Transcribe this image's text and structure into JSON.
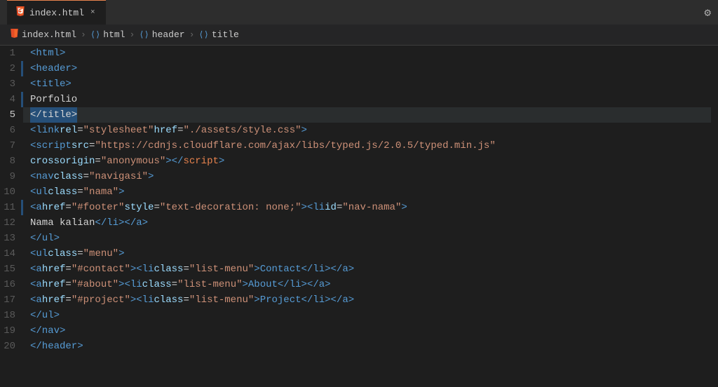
{
  "titleBar": {
    "tab": {
      "label": "index.html",
      "closeIcon": "×"
    },
    "settingsIcon": "⚙"
  },
  "breadcrumb": {
    "items": [
      {
        "label": "index.html",
        "type": "file"
      },
      {
        "label": "html",
        "type": "tag"
      },
      {
        "label": "header",
        "type": "tag"
      },
      {
        "label": "title",
        "type": "tag"
      }
    ],
    "separator": "›"
  },
  "lines": [
    {
      "num": 1,
      "hasBlueBar": false,
      "isActive": false,
      "tokens": [
        {
          "type": "c-text",
          "val": "  "
        },
        {
          "type": "c-tag",
          "val": "<html>"
        }
      ]
    },
    {
      "num": 2,
      "hasBlueBar": true,
      "isActive": false,
      "tokens": [
        {
          "type": "c-text",
          "val": "    "
        },
        {
          "type": "c-tag",
          "val": "<header>"
        }
      ]
    },
    {
      "num": 3,
      "hasBlueBar": false,
      "isActive": false,
      "tokens": [
        {
          "type": "c-text",
          "val": "        "
        },
        {
          "type": "c-tag",
          "val": "<title>"
        }
      ]
    },
    {
      "num": 4,
      "hasBlueBar": true,
      "isActive": false,
      "tokens": [
        {
          "type": "c-text",
          "val": "            Porfolio"
        }
      ]
    },
    {
      "num": 5,
      "hasBlueBar": false,
      "isActive": true,
      "isSelectedLine": true,
      "tokens": [
        {
          "type": "c-text",
          "val": "        "
        },
        {
          "type": "sel",
          "val": "</title>"
        }
      ]
    },
    {
      "num": 6,
      "hasBlueBar": false,
      "isActive": false,
      "tokens": [
        {
          "type": "c-text",
          "val": "        "
        },
        {
          "type": "c-tag",
          "val": "<link "
        },
        {
          "type": "c-attr",
          "val": "rel"
        },
        {
          "type": "c-text",
          "val": "="
        },
        {
          "type": "c-str",
          "val": "\"stylesheet\""
        },
        {
          "type": "c-text",
          "val": " "
        },
        {
          "type": "c-attr",
          "val": "href"
        },
        {
          "type": "c-text",
          "val": "="
        },
        {
          "type": "c-str",
          "val": "\"./assets/style.css\""
        },
        {
          "type": "c-tag",
          "val": ">"
        }
      ]
    },
    {
      "num": 7,
      "hasBlueBar": false,
      "isActive": false,
      "tokens": [
        {
          "type": "c-text",
          "val": "        "
        },
        {
          "type": "c-tag",
          "val": "<script "
        },
        {
          "type": "c-attr",
          "val": "src"
        },
        {
          "type": "c-text",
          "val": "="
        },
        {
          "type": "c-str",
          "val": "\"https://cdnjs.cloudflare.com/ajax/libs/typed.js/2.0.5/typed.min.js\""
        }
      ]
    },
    {
      "num": 8,
      "hasBlueBar": false,
      "isActive": false,
      "tokens": [
        {
          "type": "c-text",
          "val": "        "
        },
        {
          "type": "c-attr",
          "val": "crossorigin"
        },
        {
          "type": "c-text",
          "val": "="
        },
        {
          "type": "c-str",
          "val": "\"anonymous\""
        },
        {
          "type": "c-tag",
          "val": "></"
        },
        {
          "type": "c-orange",
          "val": "script"
        },
        {
          "type": "c-tag",
          "val": ">"
        }
      ]
    },
    {
      "num": 9,
      "hasBlueBar": false,
      "isActive": false,
      "tokens": [
        {
          "type": "c-text",
          "val": "        "
        },
        {
          "type": "c-tag",
          "val": "<nav "
        },
        {
          "type": "c-attr",
          "val": "class"
        },
        {
          "type": "c-text",
          "val": "="
        },
        {
          "type": "c-str",
          "val": "\"navigasi\""
        },
        {
          "type": "c-tag",
          "val": ">"
        }
      ]
    },
    {
      "num": 10,
      "hasBlueBar": false,
      "isActive": false,
      "tokens": [
        {
          "type": "c-text",
          "val": "            "
        },
        {
          "type": "c-tag",
          "val": "<ul "
        },
        {
          "type": "c-attr",
          "val": "class"
        },
        {
          "type": "c-text",
          "val": "="
        },
        {
          "type": "c-str",
          "val": "\"nama\""
        },
        {
          "type": "c-text",
          "val": " "
        },
        {
          "type": "c-tag",
          "val": ">"
        }
      ]
    },
    {
      "num": 11,
      "hasBlueBar": true,
      "isActive": false,
      "tokens": [
        {
          "type": "c-text",
          "val": "            "
        },
        {
          "type": "c-tag",
          "val": "<a "
        },
        {
          "type": "c-attr",
          "val": "href"
        },
        {
          "type": "c-text",
          "val": "="
        },
        {
          "type": "c-str",
          "val": "\"#footer\""
        },
        {
          "type": "c-text",
          "val": " "
        },
        {
          "type": "c-attr",
          "val": "style"
        },
        {
          "type": "c-text",
          "val": "="
        },
        {
          "type": "c-str",
          "val": "\"text-decoration: none;\""
        },
        {
          "type": "c-tag",
          "val": "><li "
        },
        {
          "type": "c-attr",
          "val": "id"
        },
        {
          "type": "c-text",
          "val": "="
        },
        {
          "type": "c-str",
          "val": "\"nav-nama\""
        },
        {
          "type": "c-tag",
          "val": ">"
        }
      ]
    },
    {
      "num": 12,
      "hasBlueBar": false,
      "isActive": false,
      "tokens": [
        {
          "type": "c-text",
          "val": "                Nama kalian"
        },
        {
          "type": "c-tag",
          "val": "</li></a>"
        }
      ]
    },
    {
      "num": 13,
      "hasBlueBar": false,
      "isActive": false,
      "tokens": [
        {
          "type": "c-text",
          "val": "            "
        },
        {
          "type": "c-tag",
          "val": "</ul>"
        }
      ]
    },
    {
      "num": 14,
      "hasBlueBar": false,
      "isActive": false,
      "tokens": [
        {
          "type": "c-text",
          "val": "            "
        },
        {
          "type": "c-tag",
          "val": "<ul "
        },
        {
          "type": "c-attr",
          "val": "class"
        },
        {
          "type": "c-text",
          "val": "="
        },
        {
          "type": "c-str",
          "val": "\"menu\""
        },
        {
          "type": "c-tag",
          "val": ">"
        }
      ]
    },
    {
      "num": 15,
      "hasBlueBar": false,
      "isActive": false,
      "tokens": [
        {
          "type": "c-text",
          "val": "                "
        },
        {
          "type": "c-tag",
          "val": "<a "
        },
        {
          "type": "c-attr",
          "val": "href"
        },
        {
          "type": "c-text",
          "val": "="
        },
        {
          "type": "c-str",
          "val": "\"#contact\""
        },
        {
          "type": "c-tag",
          "val": "><li "
        },
        {
          "type": "c-attr",
          "val": "class"
        },
        {
          "type": "c-text",
          "val": "="
        },
        {
          "type": "c-str",
          "val": "\"list-menu\""
        },
        {
          "type": "c-tag",
          "val": ">Contact</li></a>"
        }
      ]
    },
    {
      "num": 16,
      "hasBlueBar": false,
      "isActive": false,
      "tokens": [
        {
          "type": "c-text",
          "val": "                "
        },
        {
          "type": "c-tag",
          "val": "<a "
        },
        {
          "type": "c-attr",
          "val": "href"
        },
        {
          "type": "c-text",
          "val": "="
        },
        {
          "type": "c-str",
          "val": "\"#about\""
        },
        {
          "type": "c-tag",
          "val": "><li "
        },
        {
          "type": "c-attr",
          "val": "class"
        },
        {
          "type": "c-text",
          "val": "="
        },
        {
          "type": "c-str",
          "val": "\"list-menu\""
        },
        {
          "type": "c-tag",
          "val": ">About</li></a>"
        }
      ]
    },
    {
      "num": 17,
      "hasBlueBar": false,
      "isActive": false,
      "tokens": [
        {
          "type": "c-text",
          "val": "                "
        },
        {
          "type": "c-tag",
          "val": "<a "
        },
        {
          "type": "c-attr",
          "val": "href"
        },
        {
          "type": "c-text",
          "val": "="
        },
        {
          "type": "c-str",
          "val": "\"#project\""
        },
        {
          "type": "c-tag",
          "val": "><li "
        },
        {
          "type": "c-attr",
          "val": "class"
        },
        {
          "type": "c-text",
          "val": "="
        },
        {
          "type": "c-str",
          "val": "\"list-menu\""
        },
        {
          "type": "c-tag",
          "val": ">Project</li></a>"
        }
      ]
    },
    {
      "num": 18,
      "hasBlueBar": false,
      "isActive": false,
      "tokens": [
        {
          "type": "c-text",
          "val": "            "
        },
        {
          "type": "c-tag",
          "val": "</ul>"
        }
      ]
    },
    {
      "num": 19,
      "hasBlueBar": false,
      "isActive": false,
      "tokens": [
        {
          "type": "c-text",
          "val": "        "
        },
        {
          "type": "c-tag",
          "val": "</nav>"
        }
      ]
    },
    {
      "num": 20,
      "hasBlueBar": false,
      "isActive": false,
      "tokens": [
        {
          "type": "c-text",
          "val": "    "
        },
        {
          "type": "c-tag",
          "val": "</header>"
        }
      ]
    }
  ]
}
